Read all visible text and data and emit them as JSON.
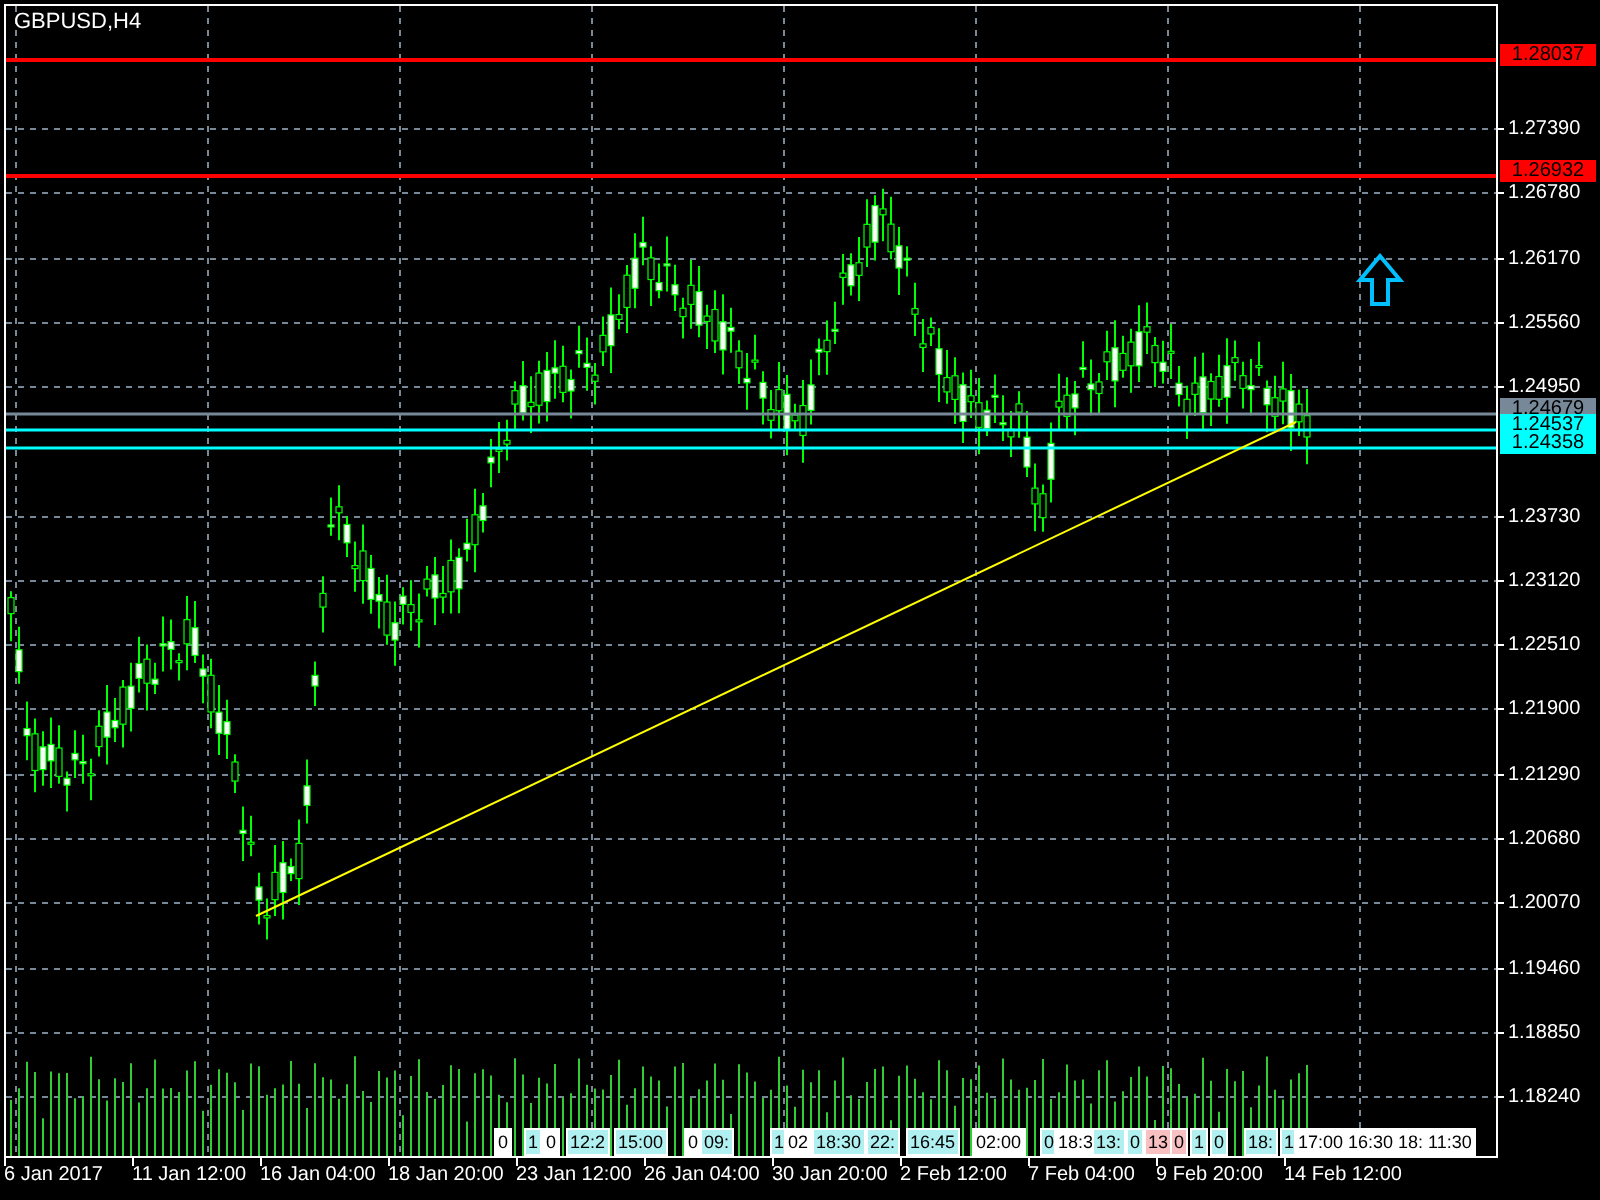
{
  "chart": {
    "title": "GBPUSD,H4",
    "price_axis": [
      "1.27390",
      "1.26780",
      "1.26170",
      "1.25560",
      "1.24950",
      "1.23730",
      "1.23120",
      "1.22510",
      "1.21900",
      "1.21290",
      "1.20680",
      "1.20070",
      "1.19460",
      "1.18850",
      "1.18240"
    ],
    "price_lines": [
      {
        "label": "1.28037",
        "color": "#ff0000"
      },
      {
        "label": "1.26932",
        "color": "#ff0000"
      },
      {
        "label": "1.24679",
        "color": "#778899"
      },
      {
        "label": "1.24537",
        "color": "#00ffff"
      },
      {
        "label": "1.24358",
        "color": "#00ffff"
      }
    ],
    "time_axis": [
      "6 Jan 2017",
      "11 Jan 12:00",
      "16 Jan 04:00",
      "18 Jan 20:00",
      "23 Jan 12:00",
      "26 Jan 04:00",
      "30 Jan 20:00",
      "2 Feb 12:00",
      "7 Feb 04:00",
      "9 Feb 20:00",
      "14 Feb 12:00"
    ],
    "time_tags": [
      {
        "text": "0",
        "color": "#ffffff"
      },
      {
        "text": "1",
        "color": "#b0f0f0"
      },
      {
        "text": "0",
        "color": "#ffffff"
      },
      {
        "text": "12:2",
        "color": "#b0f0f0"
      },
      {
        "text": "15:00",
        "color": "#b0f0f0"
      },
      {
        "text": "0",
        "color": "#ffffff"
      },
      {
        "text": "09:",
        "color": "#b0f0f0"
      },
      {
        "text": "1",
        "color": "#b0f0f0"
      },
      {
        "text": "02",
        "color": "#ffffff"
      },
      {
        "text": "18:30",
        "color": "#b0f0f0"
      },
      {
        "text": "22:",
        "color": "#b0f0f0"
      },
      {
        "text": "16:45",
        "color": "#b0f0f0"
      },
      {
        "text": "02:00",
        "color": "#ffffff"
      },
      {
        "text": "0",
        "color": "#b0f0f0"
      },
      {
        "text": "18:3",
        "color": "#ffffff"
      },
      {
        "text": "13:",
        "color": "#b0f0f0"
      },
      {
        "text": "0",
        "color": "#b0f0f0"
      },
      {
        "text": "13",
        "color": "#f8c0c0"
      },
      {
        "text": "0",
        "color": "#f8c0c0"
      },
      {
        "text": "1",
        "color": "#b0f0f0"
      },
      {
        "text": "0",
        "color": "#b0f0f0"
      },
      {
        "text": "18:",
        "color": "#b0f0f0"
      },
      {
        "text": "1",
        "color": "#b0f0f0"
      },
      {
        "text": "17:00",
        "color": "#ffffff"
      },
      {
        "text": "16:30",
        "color": "#ffffff"
      },
      {
        "text": "18:",
        "color": "#ffffff"
      },
      {
        "text": "11:30",
        "color": "#ffffff"
      }
    ]
  }
}
